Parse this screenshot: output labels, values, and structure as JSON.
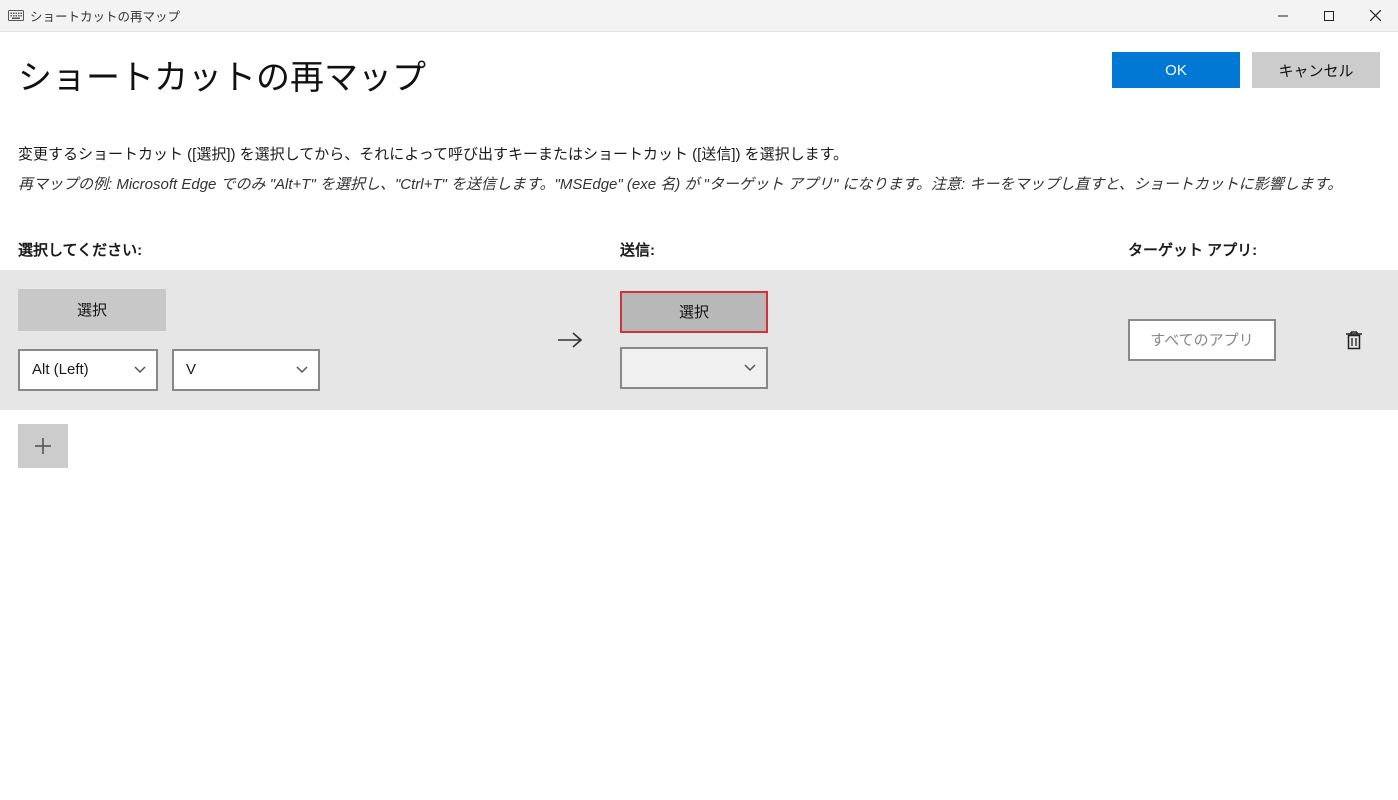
{
  "titlebar": {
    "title": "ショートカットの再マップ"
  },
  "header": {
    "page_title": "ショートカットの再マップ",
    "ok_label": "OK",
    "cancel_label": "キャンセル"
  },
  "body": {
    "description": "変更するショートカット ([選択]) を選択してから、それによって呼び出すキーまたはショートカット ([送信]) を選択します。",
    "example": "再マップの例: Microsoft Edge でのみ \"Alt+T\" を選択し、\"Ctrl+T\" を送信します。\"MSEdge\" (exe 名) が \"ターゲット アプリ\" になります。注意: キーをマップし直すと、ショートカットに影響します。"
  },
  "columns": {
    "select": "選択してください:",
    "send": "送信:",
    "target": "ターゲット アプリ:"
  },
  "row": {
    "select_button": "選択",
    "modifier_value": "Alt (Left)",
    "key_value": "V",
    "send_select_button": "選択",
    "send_dropdown_value": "",
    "target_placeholder": "すべてのアプリ"
  }
}
